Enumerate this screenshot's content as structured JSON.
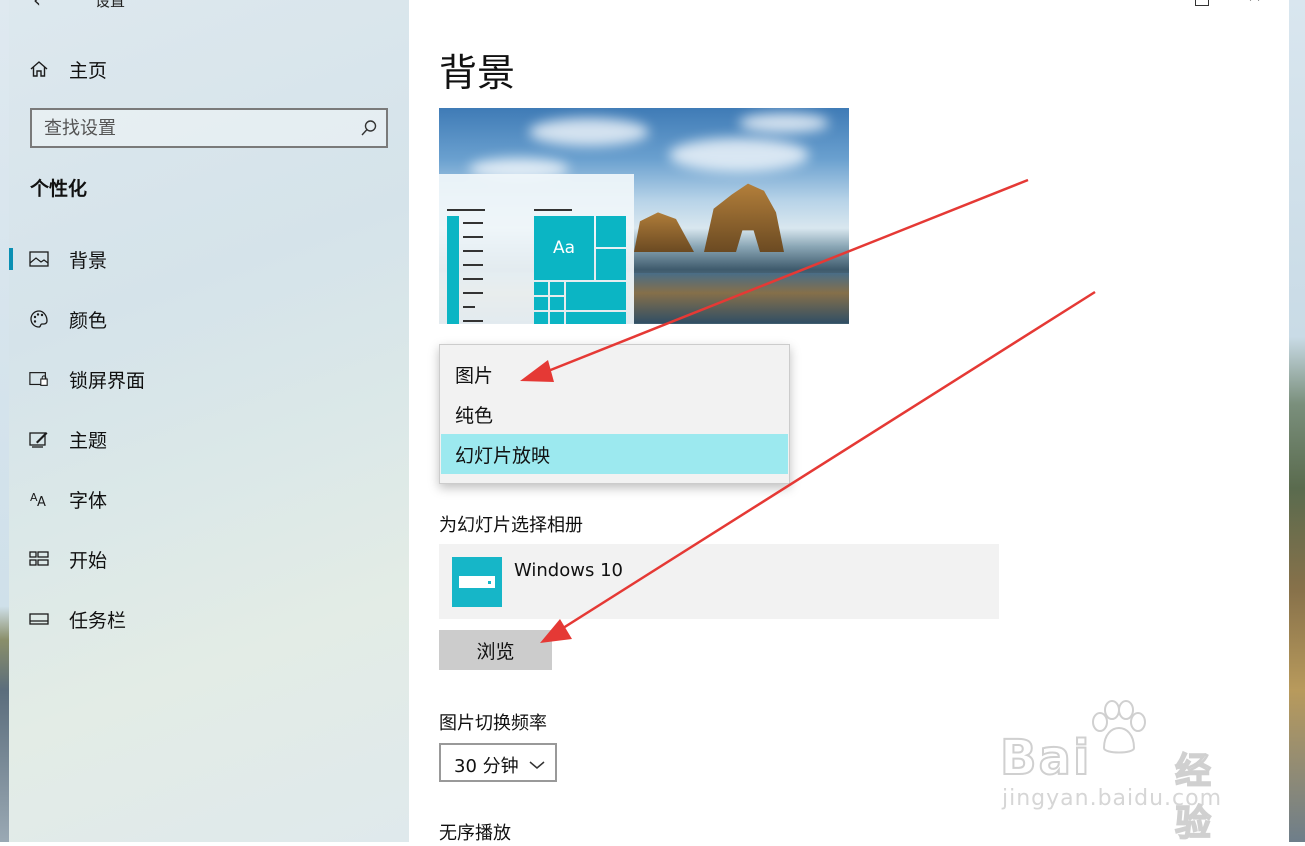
{
  "window": {
    "title": "设置",
    "back_glyph": "‹",
    "close_glyph": "✕"
  },
  "sidebar": {
    "home_label": "主页",
    "search_placeholder": "查找设置",
    "section_title": "个性化",
    "items": [
      {
        "label": "背景",
        "icon": "picture-icon",
        "active": true
      },
      {
        "label": "颜色",
        "icon": "palette-icon",
        "active": false
      },
      {
        "label": "锁屏界面",
        "icon": "lock-screen-icon",
        "active": false
      },
      {
        "label": "主题",
        "icon": "theme-icon",
        "active": false
      },
      {
        "label": "字体",
        "icon": "font-icon",
        "active": false
      },
      {
        "label": "开始",
        "icon": "start-icon",
        "active": false
      },
      {
        "label": "任务栏",
        "icon": "taskbar-icon",
        "active": false
      }
    ]
  },
  "main": {
    "page_title": "背景",
    "preview": {
      "tile_label": "Aa"
    },
    "background_dropdown": {
      "options": [
        "图片",
        "纯色",
        "幻灯片放映"
      ],
      "selected": "幻灯片放映"
    },
    "album_label": "为幻灯片选择相册",
    "album_name": "Windows 10",
    "browse_label": "浏览",
    "frequency_label": "图片切换频率",
    "frequency_value": "30 分钟",
    "shuffle_label": "无序播放"
  },
  "watermark": {
    "brand": "Bai",
    "brand_cn": "经验",
    "url": "jingyan.baidu.com"
  },
  "colors": {
    "accent": "#0a8fb3",
    "tile": "#0bb5c4",
    "selected_option": "#9ce9ef",
    "arrow": "#e53935"
  }
}
